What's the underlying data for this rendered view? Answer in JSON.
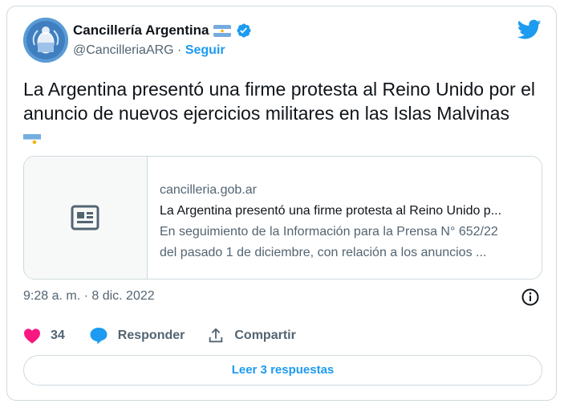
{
  "author": {
    "name": "Cancillería Argentina",
    "handle": "@CancilleriaARG",
    "separator": " · ",
    "follow_label": "Seguir",
    "verified_icon": "verified-badge-icon",
    "flag_icon": "argentina-flag-icon"
  },
  "tweet": {
    "text": "La Argentina presentó una firme protesta al Reino Unido por el anuncio de nuevos ejercicios militares en las Islas Malvinas"
  },
  "link_card": {
    "thumbnail_icon": "article-icon",
    "domain": "cancilleria.gob.ar",
    "title": "La Argentina presentó una firme protesta al Reino Unido p...",
    "description_line1": "En seguimiento de la Información para la Prensa N° 652/22",
    "description_line2": "del pasado 1 de diciembre, con relación a los anuncios ..."
  },
  "timestamp": "9:28 a. m. · 8 dic. 2022",
  "actions": {
    "like_count": "34",
    "reply_label": "Responder",
    "share_label": "Compartir"
  },
  "read_replies_label": "Leer 3 respuestas",
  "colors": {
    "accent": "#1d9bf0",
    "like": "#f91880",
    "muted": "#536471",
    "border": "#cfd9de"
  }
}
